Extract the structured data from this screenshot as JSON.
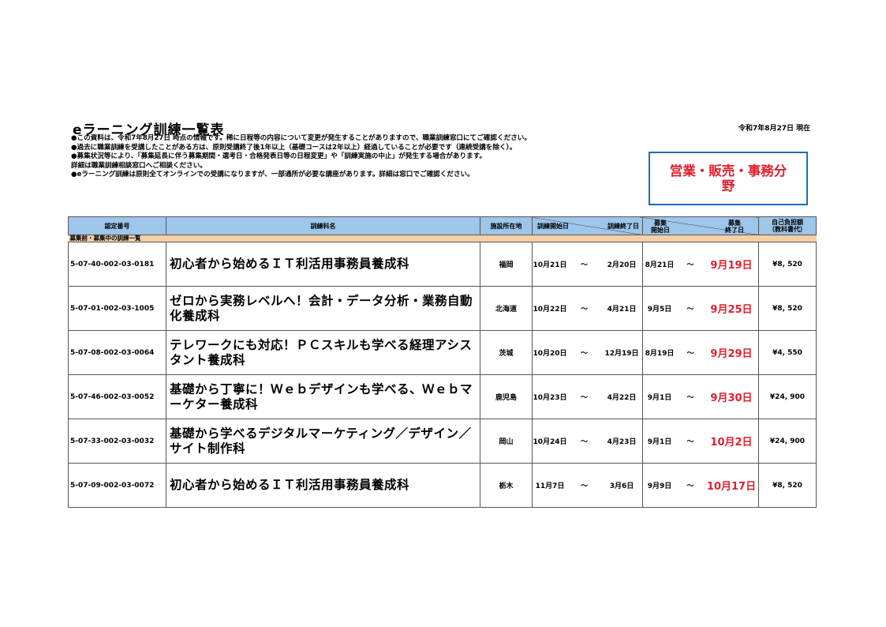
{
  "title": "eラーニング訓練一覧表",
  "as_of": "令和7年8月27日 現在",
  "notes": [
    "●この資料は、令和7年8月27日 時点の情報です。稀に日程等の内容について変更が発生することがありますので、職業訓練窓口にてご確認ください。",
    "●過去に職業訓練を受講したことがある方は、原則受講終了後1年以上（基礎コースは2年以上）経過していることが必要です（連続受講を除く）。",
    "●募集状況等により、「募集延長に伴う募集期間・選考日・合格発表日等の日程変更」や「訓練実施の中止」が発生する場合があります。",
    "詳細は職業訓練相談窓口へご相談ください。",
    "●eラーニング訓練は原則全てオンラインでの受講になりますが、一部通所が必要な講座があります。詳細は窓口でご確認ください。"
  ],
  "field_label": "営業・販売・事務分野",
  "headers": {
    "code": "認定番号",
    "name": "訓練科名",
    "location": "施設所在地",
    "train_start": "訓練開始日",
    "train_end": "訓練終了日",
    "recruit_start_1": "募集",
    "recruit_start_2": "開始日",
    "recruit_end_1": "募集",
    "recruit_end_2": "終了日",
    "fee_1": "自己負担額",
    "fee_2": "（教科書代）"
  },
  "section_label": "募集前・募集中の訓練一覧",
  "tilde": "～",
  "rows": [
    {
      "code": "5-07-40-002-03-0181",
      "name": "初心者から始めるＩＴ利活用事務員養成科",
      "location": "福岡",
      "train_start": "10月21日",
      "train_end": "2月20日",
      "recruit_start": "8月21日",
      "recruit_end": "9月19日",
      "fee": "¥8, 520"
    },
    {
      "code": "5-07-01-002-03-1005",
      "name": "ゼロから実務レベルへ！会計・データ分析・業務自動化養成科",
      "location": "北海道",
      "train_start": "10月22日",
      "train_end": "4月21日",
      "recruit_start": "9月5日",
      "recruit_end": "9月25日",
      "fee": "¥8, 520"
    },
    {
      "code": "5-07-08-002-03-0064",
      "name": "テレワークにも対応！ＰＣスキルも学べる経理アシスタント養成科",
      "location": "茨城",
      "train_start": "10月20日",
      "train_end": "12月19日",
      "recruit_start": "8月19日",
      "recruit_end": "9月29日",
      "fee": "¥4, 550"
    },
    {
      "code": "5-07-46-002-03-0052",
      "name": "基礎から丁寧に！Ｗｅｂデザインも学べる、Ｗｅｂマーケター養成科",
      "location": "鹿児島",
      "train_start": "10月23日",
      "train_end": "4月22日",
      "recruit_start": "9月1日",
      "recruit_end": "9月30日",
      "fee": "¥24, 900"
    },
    {
      "code": "5-07-33-002-03-0032",
      "name": "基礎から学べるデジタルマーケティング／デザイン／サイト制作科",
      "location": "岡山",
      "train_start": "10月24日",
      "train_end": "4月23日",
      "recruit_start": "9月1日",
      "recruit_end": "10月2日",
      "fee": "¥24, 900"
    },
    {
      "code": "5-07-09-002-03-0072",
      "name": "初心者から始めるＩＴ利活用事務員養成科",
      "location": "栃木",
      "train_start": "11月7日",
      "train_end": "3月6日",
      "recruit_start": "9月9日",
      "recruit_end": "10月17日",
      "fee": "¥8, 520"
    }
  ],
  "colors": {
    "header_bg": "#9ec5ea",
    "section_bg": "#f5cfa5",
    "accent_red": "#e0202e",
    "box_border": "#1e6bb8"
  }
}
